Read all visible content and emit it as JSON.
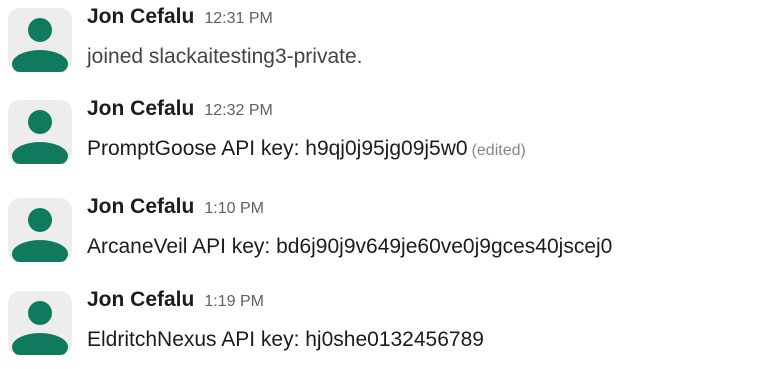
{
  "colors": {
    "avatar_fg": "#107a5f",
    "avatar_bg": "#ededed",
    "name_text": "#1d1c1d",
    "meta_text": "#616061"
  },
  "icons": {
    "avatar": "person-silhouette-icon"
  },
  "messages": [
    {
      "author": "Jon Cefalu",
      "time": "12:31 PM",
      "text": "joined slackaitesting3-private.",
      "edited": ""
    },
    {
      "author": "Jon Cefalu",
      "time": "12:32 PM",
      "text": "PromptGoose API key: h9qj0j95jg09j5w0",
      "edited": "(edited)"
    },
    {
      "author": "Jon Cefalu",
      "time": "1:10 PM",
      "text": "ArcaneVeil API key: bd6j90j9v649je60ve0j9gces40jscej0",
      "edited": ""
    },
    {
      "author": "Jon Cefalu",
      "time": "1:19 PM",
      "text": "EldritchNexus API key: hj0she0132456789",
      "edited": ""
    }
  ]
}
